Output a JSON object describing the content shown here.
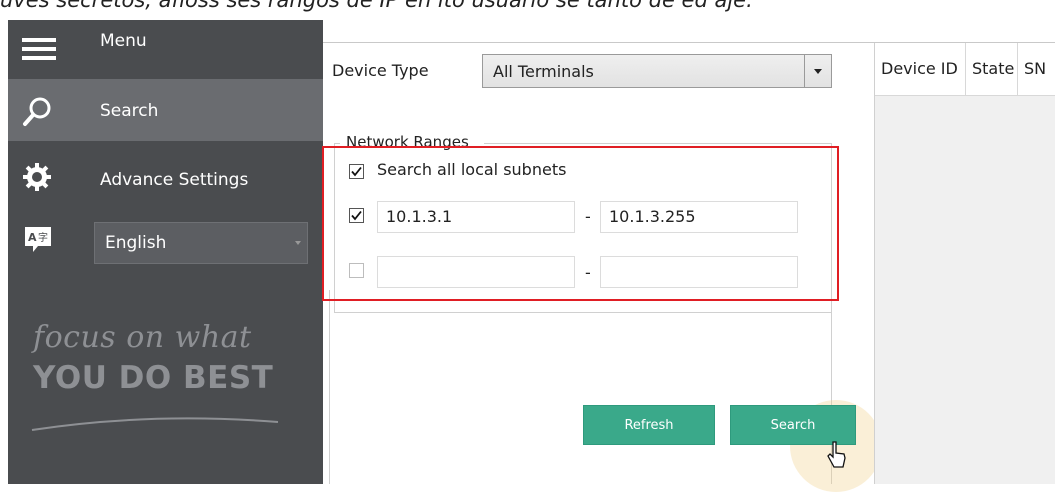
{
  "top_caption": "uves secretos, afloss ses rangos de IP en ito usuario se tanto de ed aje.",
  "sidebar": {
    "items": [
      {
        "label": "Menu",
        "icon": "hamburger-icon"
      },
      {
        "label": "Search",
        "icon": "search-icon",
        "active": true
      },
      {
        "label": "Advance Settings",
        "icon": "gear-icon"
      }
    ],
    "language": {
      "icon": "translate-icon",
      "value": "English"
    },
    "tagline_line1": "focus on what",
    "tagline_line2": "YOU DO BEST",
    "colors": {
      "background": "#4a4c4f",
      "active": "#6a6c70",
      "tagline": "#8e9094"
    }
  },
  "form": {
    "device_type_label": "Device Type",
    "device_type_value": "All Terminals",
    "network_ranges": {
      "legend": "Network Ranges",
      "search_all_label": "Search all local subnets",
      "search_all_checked": true,
      "ranges": [
        {
          "enabled": true,
          "start": "10.1.3.1",
          "end": "10.1.3.255"
        },
        {
          "enabled": false,
          "start": "",
          "end": ""
        }
      ],
      "separator": "-"
    },
    "highlight_color": "#e01e24"
  },
  "buttons": {
    "refresh": "Refresh",
    "search": "Search",
    "color": "#3aa98a"
  },
  "results_table": {
    "columns": [
      "Device ID",
      "State",
      "SN"
    ]
  }
}
